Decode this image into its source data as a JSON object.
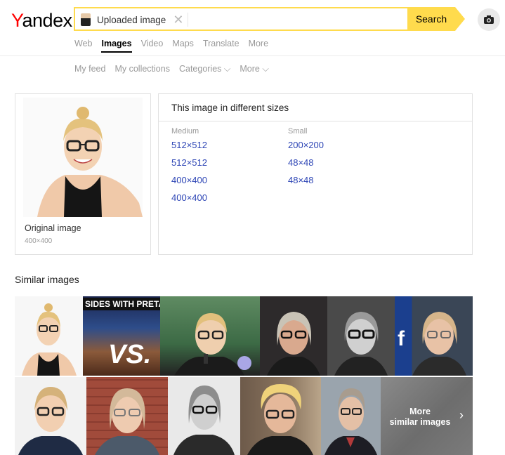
{
  "header": {
    "logo_first": "Y",
    "logo_rest": "andex",
    "search_chip": "Uploaded image",
    "search_button": "Search"
  },
  "tabs": [
    "Web",
    "Images",
    "Video",
    "Maps",
    "Translate",
    "More"
  ],
  "active_tab": "Images",
  "subnav": [
    "My feed",
    "My collections",
    "Categories ⌵",
    "More ⌵"
  ],
  "original": {
    "label": "Original image",
    "size": "400×400"
  },
  "sizes": {
    "title": "This image in different sizes",
    "medium_label": "Medium",
    "small_label": "Small",
    "medium": [
      "512×512",
      "512×512",
      "400×400",
      "400×400"
    ],
    "small": [
      "200×200",
      "48×48",
      "48×48"
    ]
  },
  "similar": {
    "title": "Similar images",
    "more_line1": "More",
    "more_line2": "similar images",
    "banner_text_1": "SIDES WITH PRETA",
    "banner_text_2": "VS."
  },
  "colors": {
    "brand_red": "#ff0000",
    "search_yellow": "#ffdb4d",
    "link_blue": "#2d45b5"
  },
  "icons": [
    "close-icon",
    "camera-icon",
    "chevron-right-icon"
  ]
}
